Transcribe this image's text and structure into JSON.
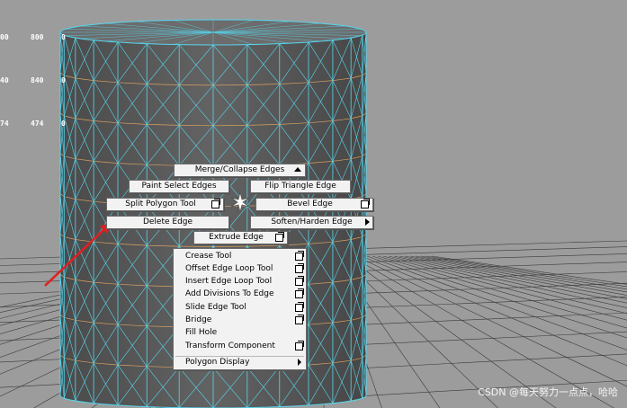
{
  "hud": {
    "rows": [
      [
        "00",
        "800",
        "0"
      ],
      [
        "40",
        "840",
        "0"
      ],
      [
        "74",
        "474",
        "0"
      ]
    ]
  },
  "colors": {
    "viewport_bg": "#9c9c9c",
    "mesh_fill": "#5a5a5a",
    "edge_wire": "#57d6ee",
    "loop_wire": "#d8a060",
    "grid_line": "#3a3a3a",
    "arrow": "#e02020"
  },
  "marking_menu": {
    "north": {
      "label": "Merge/Collapse Edges",
      "icon": "triangle-up-icon"
    },
    "northwest": {
      "label": "Paint Select Edges"
    },
    "northeast": {
      "label": "Flip Triangle Edge"
    },
    "west": {
      "label": "Split Polygon Tool",
      "icon": "option-box-icon"
    },
    "east": {
      "label": "Bevel Edge",
      "icon": "option-box-icon"
    },
    "southwest": {
      "label": "Delete Edge"
    },
    "southeast": {
      "label": "Soften/Harden Edge",
      "icon": "submenu-arrow-icon"
    },
    "south": {
      "label": "Extrude Edge",
      "icon": "option-box-icon"
    }
  },
  "edge_menu": {
    "items": [
      {
        "label": "Crease Tool",
        "has_option": true
      },
      {
        "label": "Offset Edge Loop Tool",
        "has_option": true
      },
      {
        "label": "Insert Edge Loop Tool",
        "has_option": true
      },
      {
        "label": "Add Divisions To Edge",
        "has_option": true
      },
      {
        "label": "Slide Edge Tool",
        "has_option": true
      },
      {
        "label": "Bridge",
        "has_option": true
      },
      {
        "label": "Fill Hole",
        "has_option": false
      },
      {
        "label": "Transform Component",
        "has_option": true
      }
    ],
    "footer": {
      "label": "Polygon Display",
      "icon": "submenu-arrow-icon"
    }
  },
  "watermark": "CSDN @每天努力一点点，哈哈"
}
